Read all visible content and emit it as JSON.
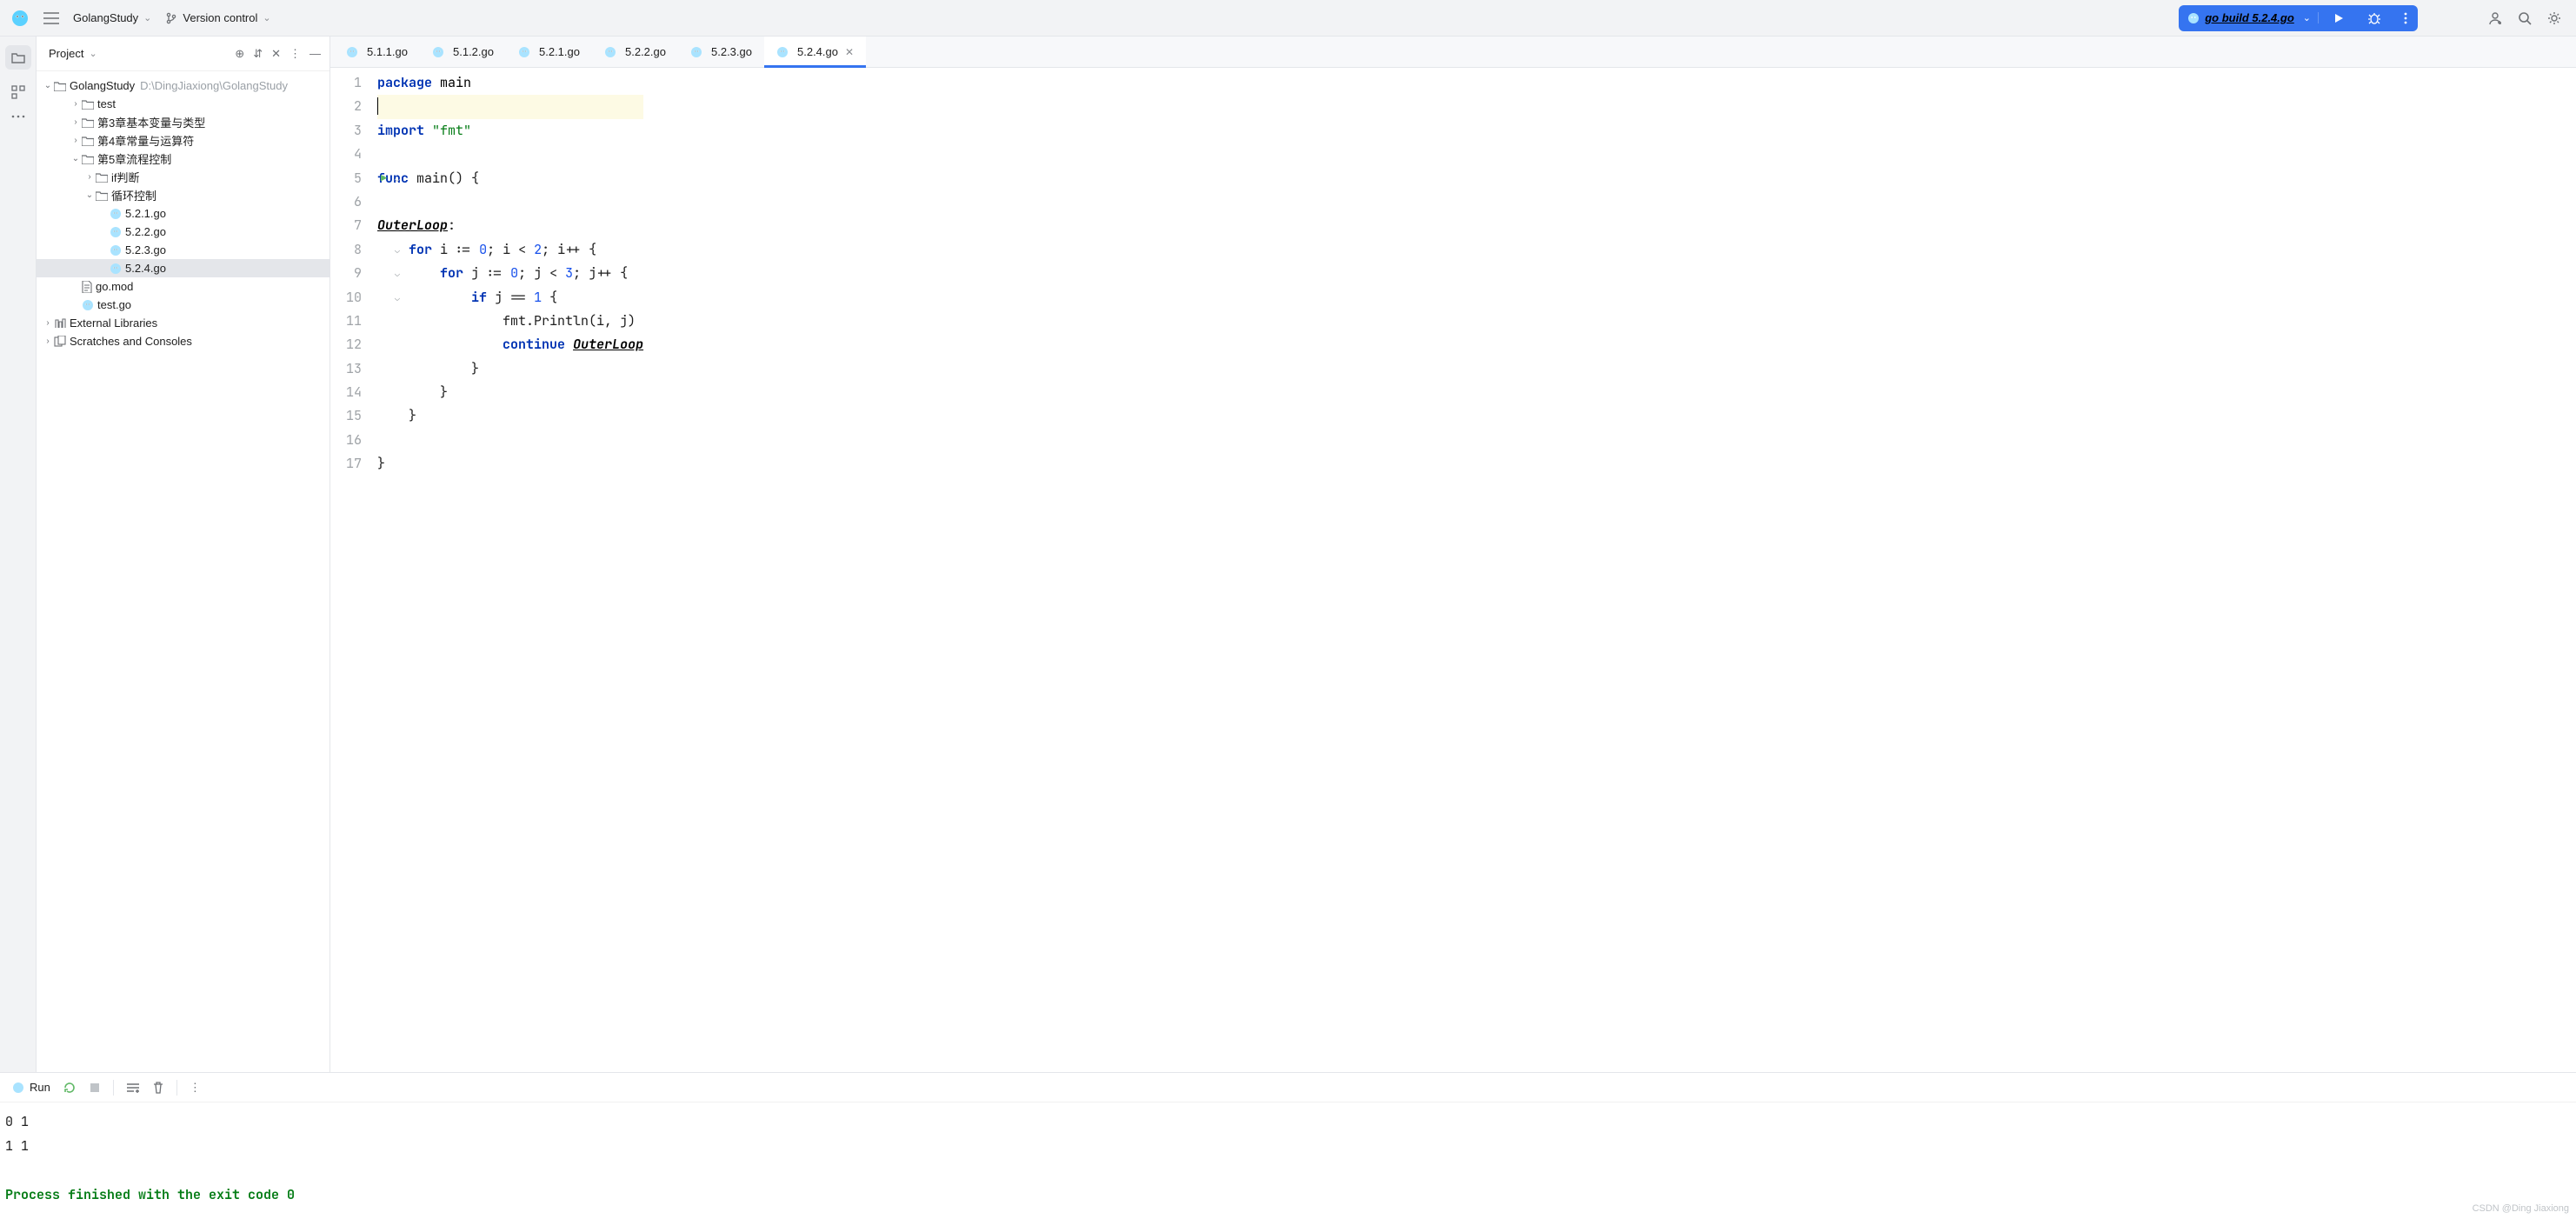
{
  "topbar": {
    "project": "GolangStudy",
    "vc": "Version control",
    "run_config": "go build 5.2.4.go"
  },
  "project_pane": {
    "title": "Project",
    "root": {
      "name": "GolangStudy",
      "path": "D:\\DingJiaxiong\\GolangStudy"
    },
    "items": [
      {
        "name": "test",
        "depth": 1,
        "type": "dir",
        "expand": "right"
      },
      {
        "name": "第3章基本变量与类型",
        "depth": 1,
        "type": "dir",
        "expand": "right"
      },
      {
        "name": "第4章常量与运算符",
        "depth": 1,
        "type": "dir",
        "expand": "right"
      },
      {
        "name": "第5章流程控制",
        "depth": 1,
        "type": "dir",
        "expand": "down"
      },
      {
        "name": "if判断",
        "depth": 2,
        "type": "dir",
        "expand": "right"
      },
      {
        "name": "循环控制",
        "depth": 2,
        "type": "dir",
        "expand": "down"
      },
      {
        "name": "5.2.1.go",
        "depth": 3,
        "type": "go"
      },
      {
        "name": "5.2.2.go",
        "depth": 3,
        "type": "go"
      },
      {
        "name": "5.2.3.go",
        "depth": 3,
        "type": "go"
      },
      {
        "name": "5.2.4.go",
        "depth": 3,
        "type": "go",
        "selected": true
      },
      {
        "name": "go.mod",
        "depth": 1,
        "type": "file"
      },
      {
        "name": "test.go",
        "depth": 1,
        "type": "go"
      }
    ],
    "externals": "External Libraries",
    "scratches": "Scratches and Consoles"
  },
  "tabs": [
    {
      "name": "5.1.1.go"
    },
    {
      "name": "5.1.2.go"
    },
    {
      "name": "5.2.1.go"
    },
    {
      "name": "5.2.2.go"
    },
    {
      "name": "5.2.3.go"
    },
    {
      "name": "5.2.4.go",
      "active": true
    }
  ],
  "code": {
    "lines": [
      {
        "n": 1,
        "t": [
          [
            "kw",
            "package "
          ],
          [
            "ident",
            "main"
          ]
        ]
      },
      {
        "n": 2,
        "t": [
          [
            "cursor",
            ""
          ]
        ],
        "hl": true
      },
      {
        "n": 3,
        "t": [
          [
            "kw",
            "import "
          ],
          [
            "str",
            "\"fmt\""
          ]
        ]
      },
      {
        "n": 4,
        "t": []
      },
      {
        "n": 5,
        "t": [
          [
            "kw",
            "func "
          ],
          [
            "fn",
            "main"
          ],
          [
            "",
            "() {"
          ]
        ],
        "run": true,
        "fold": true
      },
      {
        "n": 6,
        "t": []
      },
      {
        "n": 7,
        "t": [
          [
            "label",
            "OuterLoop"
          ],
          [
            "",
            ":"
          ]
        ]
      },
      {
        "n": 8,
        "t": [
          [
            "",
            "    "
          ],
          [
            "kw",
            "for"
          ],
          [
            "",
            " i := "
          ],
          [
            "num",
            "0"
          ],
          [
            "",
            "; i < "
          ],
          [
            "num",
            "2"
          ],
          [
            "",
            "; i++ {"
          ]
        ],
        "fold": true
      },
      {
        "n": 9,
        "t": [
          [
            "",
            "        "
          ],
          [
            "kw",
            "for"
          ],
          [
            "",
            " j := "
          ],
          [
            "num",
            "0"
          ],
          [
            "",
            "; j < "
          ],
          [
            "num",
            "3"
          ],
          [
            "",
            "; j++ {"
          ]
        ],
        "fold": true
      },
      {
        "n": 10,
        "t": [
          [
            "",
            "            "
          ],
          [
            "kw",
            "if"
          ],
          [
            "",
            " j == "
          ],
          [
            "num",
            "1"
          ],
          [
            "",
            " {"
          ]
        ],
        "fold": true
      },
      {
        "n": 11,
        "t": [
          [
            "",
            "                fmt.Println(i, j)"
          ]
        ]
      },
      {
        "n": 12,
        "t": [
          [
            "",
            "                "
          ],
          [
            "kw",
            "continue"
          ],
          [
            "",
            " "
          ],
          [
            "label",
            "OuterLoop"
          ]
        ]
      },
      {
        "n": 13,
        "t": [
          [
            "",
            "            }"
          ]
        ]
      },
      {
        "n": 14,
        "t": [
          [
            "",
            "        }"
          ]
        ]
      },
      {
        "n": 15,
        "t": [
          [
            "",
            "    }"
          ]
        ]
      },
      {
        "n": 16,
        "t": []
      },
      {
        "n": 17,
        "t": [
          [
            "",
            "}"
          ]
        ]
      }
    ]
  },
  "run": {
    "title": "Run",
    "output": [
      "0 1",
      "1 1",
      "",
      "Process finished with the exit code 0"
    ]
  },
  "watermark": "CSDN @Ding Jiaxiong"
}
